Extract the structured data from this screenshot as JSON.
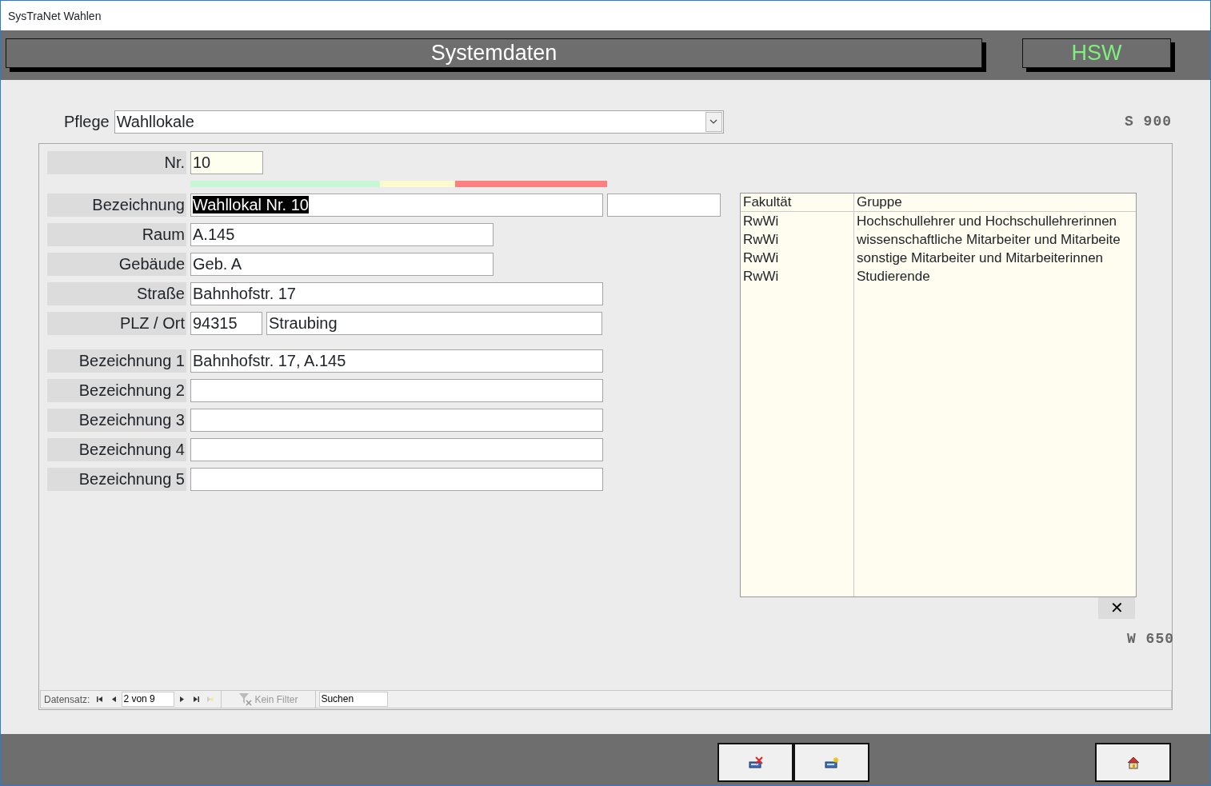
{
  "window": {
    "title": "SysTraNet Wahlen"
  },
  "header": {
    "title": "Systemdaten",
    "badge": "HSW"
  },
  "pflege": {
    "label": "Pflege",
    "value": "Wahllokale"
  },
  "code_top": "S 900",
  "nr": {
    "label": "Nr.",
    "value": "10"
  },
  "fields": [
    {
      "kind": "extra",
      "label": "Bezeichnung",
      "value": "Wahllokal Nr. 10",
      "value_selected": true
    },
    {
      "kind": "medium",
      "label": "Raum",
      "value": "A.145",
      "value_selected": false
    },
    {
      "kind": "medium",
      "label": "Gebäude",
      "value": "Geb. A",
      "value_selected": false
    },
    {
      "kind": "wide",
      "label": "Straße",
      "value": "Bahnhofstr. 17",
      "value_selected": false
    },
    {
      "kind": "plz_ort",
      "label": "PLZ / Ort",
      "value": "94315",
      "value_2": "Straubing",
      "value_selected": false
    }
  ],
  "descriptions": [
    {
      "label": "Bezeichnung 1",
      "value": "Bahnhofstr. 17, A.145"
    },
    {
      "label": "Bezeichnung 2"
    },
    {
      "label": "Bezeichnung 3"
    },
    {
      "label": "Bezeichnung 4"
    },
    {
      "label": "Bezeichnung 5"
    }
  ],
  "grid": {
    "columns": [
      "Fakultät",
      "Gruppe"
    ],
    "rows": [
      [
        "RwWi",
        "Hochschullehrer und Hochschullehrerinnen"
      ],
      [
        "RwWi",
        "wissenschaftliche Mitarbeiter und Mitarbeite"
      ],
      [
        "RwWi",
        "sonstige Mitarbeiter und Mitarbeiterinnen"
      ],
      [
        "RwWi",
        "Studierende"
      ]
    ],
    "delete_symbol": "✕"
  },
  "code_bottom": "W 650",
  "navigator": {
    "label": "Datensatz:",
    "position": "2 von 9",
    "filter": "Kein Filter",
    "search": "Suchen"
  }
}
